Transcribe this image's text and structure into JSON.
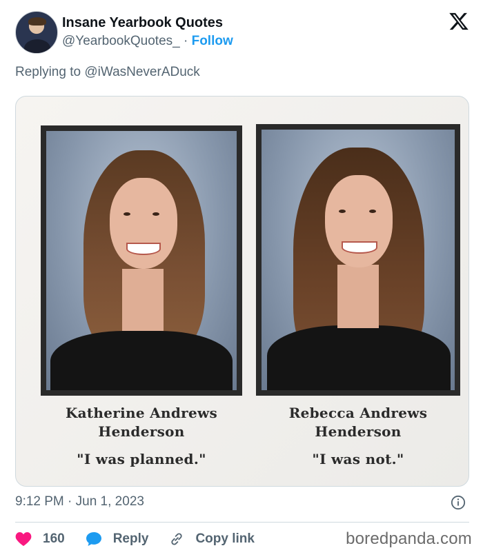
{
  "tweet": {
    "display_name": "Insane Yearbook Quotes",
    "handle": "@YearbookQuotes_",
    "separator": "·",
    "follow_label": "Follow",
    "replying_prefix": "Replying to",
    "replying_to": "@iWasNeverADuck",
    "timestamp": "9:12 PM · Jun 1, 2023"
  },
  "media": {
    "left": {
      "name_line1": "Katherine Andrews",
      "name_line2": "Henderson",
      "quote": "\"I was planned.\""
    },
    "right": {
      "name_line1": "Rebecca Andrews",
      "name_line2": "Henderson",
      "quote": "\"I was not.\""
    }
  },
  "actions": {
    "like_count": "160",
    "reply_label": "Reply",
    "copy_link_label": "Copy link"
  },
  "watermark": "boredpanda.com",
  "colors": {
    "accent": "#1d9bf0",
    "like": "#f91880",
    "secondary_text": "#536471"
  },
  "icons": [
    "x-logo-icon",
    "info-icon",
    "heart-icon",
    "reply-bubble-icon",
    "link-icon"
  ]
}
